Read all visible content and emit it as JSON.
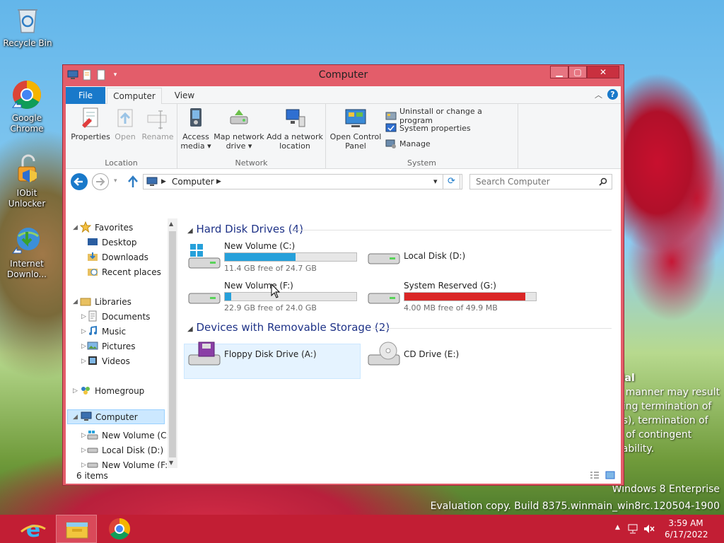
{
  "desktop": {
    "icons": [
      {
        "label": "Recycle Bin",
        "icon": "recycle-bin-icon"
      },
      {
        "label": "Google Chrome",
        "icon": "chrome-icon"
      },
      {
        "label": "IObit Unlocker",
        "icon": "iobit-unlocker-icon"
      },
      {
        "label": "Internet Downlo...",
        "icon": "internet-download-manager-icon"
      }
    ],
    "legal_lines": [
      "tial",
      "y manner may result",
      "ding termination of",
      "es), termination of",
      "e of contingent",
      "liability."
    ],
    "watermark_line1": "Windows 8 Enterprise",
    "watermark_line2": "Evaluation copy. Build 8375.winmain_win8rc.120504-1900"
  },
  "window": {
    "title": "Computer",
    "buttons": {
      "minimize": "▁",
      "maximize": "▢",
      "close": "✕"
    },
    "tabs": {
      "file": "File",
      "computer": "Computer",
      "view": "View"
    },
    "help": "?",
    "ribbon": {
      "location": {
        "label": "Location",
        "properties": "Properties",
        "open": "Open",
        "rename": "Rename"
      },
      "network": {
        "label": "Network",
        "access_media_1": "Access",
        "access_media_2": "media",
        "map_drive_1": "Map network",
        "map_drive_2": "drive",
        "add_location_1": "Add a network",
        "add_location_2": "location"
      },
      "system": {
        "label": "System",
        "control_panel_1": "Open Control",
        "control_panel_2": "Panel",
        "uninstall": "Uninstall or change a program",
        "sys_props": "System properties",
        "manage": "Manage"
      }
    },
    "address": {
      "path": "Computer",
      "search_placeholder": "Search Computer"
    },
    "nav": {
      "favorites": "Favorites",
      "desktop": "Desktop",
      "downloads": "Downloads",
      "recent": "Recent places",
      "libraries": "Libraries",
      "documents": "Documents",
      "music": "Music",
      "pictures": "Pictures",
      "videos": "Videos",
      "homegroup": "Homegroup",
      "computer": "Computer",
      "drive_c": "New Volume (C:)",
      "drive_d": "Local Disk (D:)",
      "drive_f": "New Volume (F:)",
      "drive_g": "System Reserved"
    },
    "content": {
      "hdd_header": "Hard Disk Drives (4)",
      "removable_header": "Devices with Removable Storage (2)",
      "drives": [
        {
          "name": "New Volume (C:)",
          "free": "11.4 GB free of 24.7 GB",
          "used_fraction": 0.54
        },
        {
          "name": "Local Disk (D:)"
        },
        {
          "name": "New Volume (F:)",
          "free": "22.9 GB free of 24.0 GB",
          "used_fraction": 0.05
        },
        {
          "name": "System Reserved (G:)",
          "free": "4.00 MB free of 49.9 MB",
          "used_fraction": 0.92
        }
      ],
      "removable": [
        {
          "name": "Floppy Disk Drive (A:)"
        },
        {
          "name": "CD Drive (E:)"
        }
      ]
    },
    "status": {
      "items": "6 items"
    }
  },
  "taskbar": {
    "time": "3:59 AM",
    "date": "6/17/2022"
  },
  "colors": {
    "accent": "#1979ca",
    "window_frame": "#e35d6a",
    "taskbar": "#c21e34",
    "drive_bar": "#26a0da",
    "drive_bar_full": "#da2626"
  }
}
